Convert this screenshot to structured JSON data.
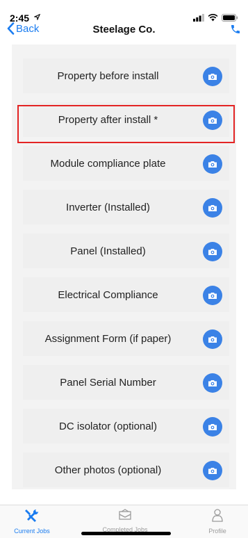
{
  "status_bar": {
    "time": "2:45"
  },
  "nav": {
    "back_label": "Back",
    "title": "Steelage Co."
  },
  "items": [
    {
      "label": "Property before install",
      "icon": "camera-icon"
    },
    {
      "label": "Property after install *",
      "icon": "camera-icon"
    },
    {
      "label": "Module compliance plate",
      "icon": "camera-icon"
    },
    {
      "label": "Inverter (Installed)",
      "icon": "camera-icon"
    },
    {
      "label": "Panel (Installed)",
      "icon": "camera-icon"
    },
    {
      "label": "Electrical Compliance",
      "icon": "camera-icon"
    },
    {
      "label": "Assignment Form (if paper)",
      "icon": "camera-icon"
    },
    {
      "label": "Panel Serial Number",
      "icon": "camera-icon"
    },
    {
      "label": "DC isolator (optional)",
      "icon": "camera-icon"
    },
    {
      "label": "Other photos (optional)",
      "icon": "camera-icon"
    }
  ],
  "tabs": [
    {
      "label": "Current Jobs",
      "icon": "tools-icon",
      "active": true
    },
    {
      "label": "Completed Jobs",
      "icon": "envelope-icon",
      "active": false
    },
    {
      "label": "Profile",
      "icon": "person-icon",
      "active": false
    }
  ],
  "colors": {
    "accent": "#1a7cf0",
    "camera_button": "#3b82e6",
    "highlight": "#e32424"
  }
}
